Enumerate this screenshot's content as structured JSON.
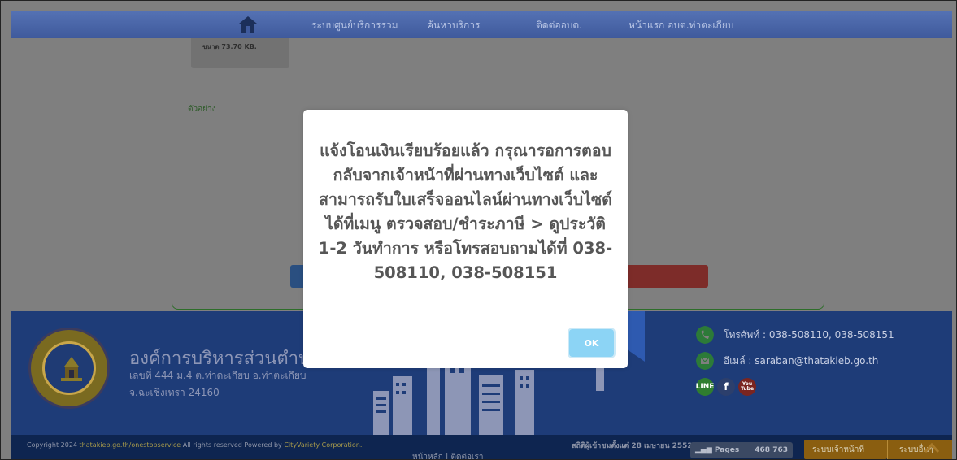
{
  "nav": {
    "items": [
      "ระบบศูนย์บริการร่วม",
      "ค้นหาบริการ",
      "ติดต่ออบต.",
      "หน้าแรก อบต.ท่าตะเกียบ"
    ]
  },
  "content": {
    "file_size": "ขนาด 73.70 KB.",
    "example_label": "ตัวอย่าง"
  },
  "footer": {
    "org_name": "องค์การบริหารส่วนตำบล",
    "address_line1": "เลขที่ 444 ม.4 ต.ท่าตะเกียบ อ.ท่าตะเกียบ",
    "address_line2": "จ.ฉะเชิงเทรา 24160",
    "phone": "โทรศัพท์ : 038-508110, 038-508151",
    "email": "อีเมล์ : saraban@thatakieb.go.th",
    "social": [
      "LINE",
      "f",
      "You Tube"
    ]
  },
  "bottom_bar": {
    "copyright_prefix": "Copyright 2024 ",
    "copyright_link": "thatakieb.go.th/onestopservice",
    "copyright_middle": " All rights reserved Powered by ",
    "copyright_company": "CityVariety Corporation.",
    "links": "หน้าหลัก | ติดต่อเรา",
    "stats_label": "สถิติผู้เข้าชมตั้งแต่ 28 เมษายน 2552",
    "counter_label": "Pages",
    "counter_value": "468 763",
    "staff_button": "ระบบเจ้าหน้าที่",
    "other_button": "ระบบอื่นๆ"
  },
  "modal": {
    "message": "แจ้งโอนเงินเรียบร้อยแล้ว กรุณารอการตอบกลับจากเจ้าหน้าที่ผ่านทางเว็บไซต์ และสามารถรับใบเสร็จออนไลน์ผ่านทางเว็บไซต์ได้ที่เมนู ตรวจสอบ/ชำระภาษี > ดูประวัติ 1-2 วันทำการ หรือโทรสอบถามได้ที่ 038-508110, 038-508151",
    "ok_label": "OK"
  },
  "colors": {
    "overlay": "#7f7f7f",
    "ok_button": "#8cd4f5",
    "footer": "#1e3c78",
    "nav": "#4a66a8"
  },
  "icons": [
    "home-icon",
    "phone-icon",
    "email-icon",
    "line-icon",
    "facebook-icon",
    "youtube-icon",
    "scroll-top-icon"
  ]
}
